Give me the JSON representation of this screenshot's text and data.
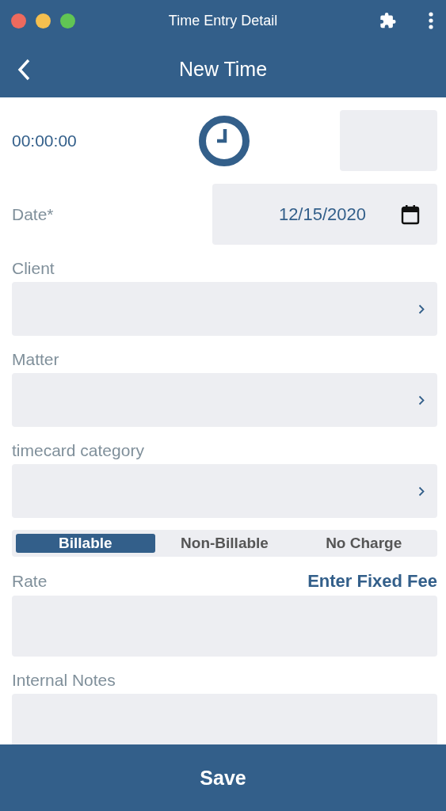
{
  "window": {
    "title": "Time Entry Detail"
  },
  "header": {
    "title": "New Time"
  },
  "timer": {
    "value": "00:00:00"
  },
  "date": {
    "label": "Date*",
    "value": "12/15/2020"
  },
  "fields": [
    {
      "label": "Client",
      "kind": "select"
    },
    {
      "label": "Matter",
      "kind": "select"
    },
    {
      "label": "timecard category",
      "kind": "select"
    }
  ],
  "billing_tabs": [
    {
      "label": "Billable",
      "selected": true
    },
    {
      "label": "Non-Billable",
      "selected": false
    },
    {
      "label": "No Charge",
      "selected": false
    }
  ],
  "rate": {
    "label": "Rate",
    "link": "Enter Fixed Fee"
  },
  "notes": {
    "label": "Internal Notes"
  },
  "save_button": "Save"
}
